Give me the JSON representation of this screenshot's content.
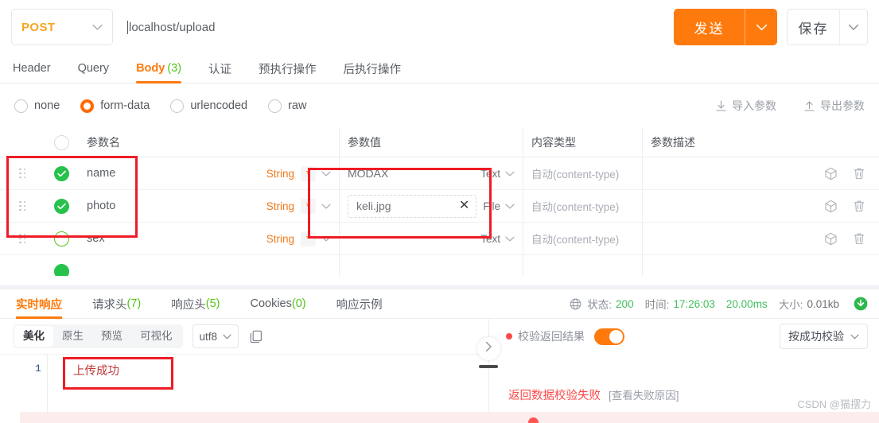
{
  "request": {
    "method": "POST",
    "url": "localhost/upload",
    "send_label": "发送",
    "save_label": "保存",
    "tabs": [
      {
        "label": "Header",
        "count": "",
        "active": false
      },
      {
        "label": "Query",
        "count": "",
        "active": false
      },
      {
        "label": "Body",
        "count": "(3)",
        "active": true
      },
      {
        "label": "认证",
        "count": "",
        "active": false
      },
      {
        "label": "预执行操作",
        "count": "",
        "active": false
      },
      {
        "label": "后执行操作",
        "count": "",
        "active": false
      }
    ],
    "body_types": [
      {
        "label": "none",
        "checked": false
      },
      {
        "label": "form-data",
        "checked": true
      },
      {
        "label": "urlencoded",
        "checked": false
      },
      {
        "label": "raw",
        "checked": false
      }
    ],
    "import_label": "导入参数",
    "export_label": "导出参数"
  },
  "table": {
    "headers": {
      "name": "参数名",
      "value": "参数值",
      "content_type": "内容类型",
      "description": "参数描述"
    },
    "rows": [
      {
        "name": "name",
        "checked": true,
        "type": "String",
        "required": "*",
        "value": "MODAX",
        "value_kind": "Text",
        "is_file": false,
        "content_type": "自动(content-type)",
        "description": ""
      },
      {
        "name": "photo",
        "checked": true,
        "type": "String",
        "required": "*",
        "value": "keli.jpg",
        "value_kind": "File",
        "is_file": true,
        "content_type": "自动(content-type)",
        "description": ""
      },
      {
        "name": "sex",
        "checked": false,
        "type": "String",
        "required": "*",
        "value": "",
        "value_kind": "Text",
        "is_file": false,
        "content_type": "自动(content-type)",
        "description": ""
      }
    ]
  },
  "response": {
    "tabs": [
      {
        "label": "实时响应",
        "count": "",
        "active": true
      },
      {
        "label": "请求头",
        "count": "(7)",
        "active": false
      },
      {
        "label": "响应头",
        "count": "(5)",
        "active": false
      },
      {
        "label": "Cookies",
        "count": "(0)",
        "active": false
      },
      {
        "label": "响应示例",
        "count": "",
        "active": false
      }
    ],
    "status": {
      "status_label": "状态:",
      "status_value": "200",
      "time_label": "时间:",
      "time_value": "17:26:03",
      "duration_value": "20.00ms",
      "size_label": "大小:",
      "size_value": "0.01kb"
    },
    "view_modes": [
      {
        "label": "美化",
        "active": true
      },
      {
        "label": "原生",
        "active": false
      },
      {
        "label": "预览",
        "active": false
      },
      {
        "label": "可视化",
        "active": false
      }
    ],
    "encoding": "utf8",
    "body_line_number": "1",
    "body_text": "上传成功"
  },
  "verify": {
    "label": "校验返回结果",
    "toggle_on": true,
    "mode": "按成功校验",
    "fail_text": "返回数据校验失败",
    "fail_link": "[查看失败原因]"
  },
  "watermark": "CSDN @猫摆力",
  "colors": {
    "accent": "#ff7a0c",
    "success": "#52c41a",
    "danger": "#fa4a4a",
    "annotation": "#ee1c25"
  }
}
